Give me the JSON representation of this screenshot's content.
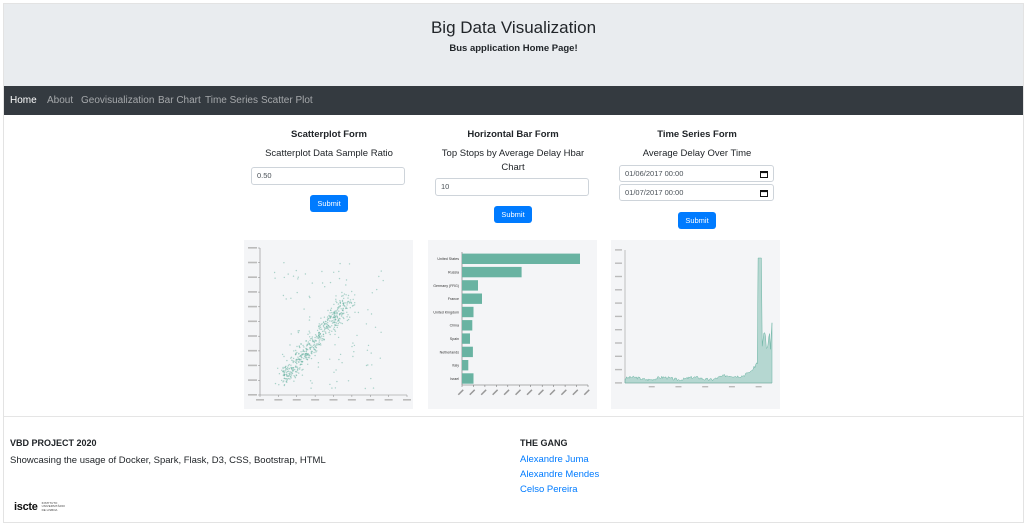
{
  "header": {
    "title": "Big Data Visualization",
    "subtitle": "Bus application Home Page!"
  },
  "nav": {
    "items": [
      "Home",
      "About",
      "Geovisualization",
      "Bar Chart",
      "Time Series",
      "Scatter Plot"
    ],
    "active": "Home"
  },
  "forms": {
    "scatter": {
      "title": "Scatterplot Form",
      "desc": "Scatterplot Data Sample Ratio",
      "value": "0.50",
      "submit": "Submit"
    },
    "hbar": {
      "title": "Horizontal Bar Form",
      "desc_line1": "Top Stops by Average Delay Hbar",
      "desc_line2": "Chart",
      "value": "10",
      "submit": "Submit"
    },
    "timeseries": {
      "title": "Time Series Form",
      "desc": "Average Delay Over Time",
      "start": "01/06/2017 00:00",
      "end": "01/07/2017 00:00",
      "submit": "Submit"
    }
  },
  "footer": {
    "project_title": "VBD PROJECT 2020",
    "project_desc": "Showcasing the usage of Docker, Spark, Flask, D3, CSS, Bootstrap, HTML",
    "gang_title": "THE GANG",
    "members": [
      "Alexandre Juma",
      "Alexandre Mendes",
      "Celso Pereira"
    ],
    "logo_text": "iscte",
    "logo_small": [
      "INSTITUTO",
      "UNIVERSITÁRIO",
      "DE LISBOA"
    ]
  },
  "colors": {
    "accent": "#007bff",
    "navbar": "#343a40",
    "jumbotron": "#e9ecef",
    "chart_green": "#69b3a2"
  },
  "chart_data": [
    {
      "type": "scatter",
      "point_count": 600,
      "note": "dense positive correlation cluster"
    },
    {
      "type": "bar",
      "orientation": "horizontal",
      "categories": [
        "United States",
        "Russia",
        "Germany (FRG)",
        "France",
        "United Kingdom",
        "China",
        "Spain",
        "Netherlands",
        "Italy",
        "Israel"
      ],
      "values": [
        1030,
        520,
        140,
        175,
        100,
        90,
        70,
        95,
        55,
        100
      ],
      "xlim": [
        0,
        1100
      ]
    },
    {
      "type": "area",
      "note": "flat low values then sharp late spike"
    }
  ]
}
